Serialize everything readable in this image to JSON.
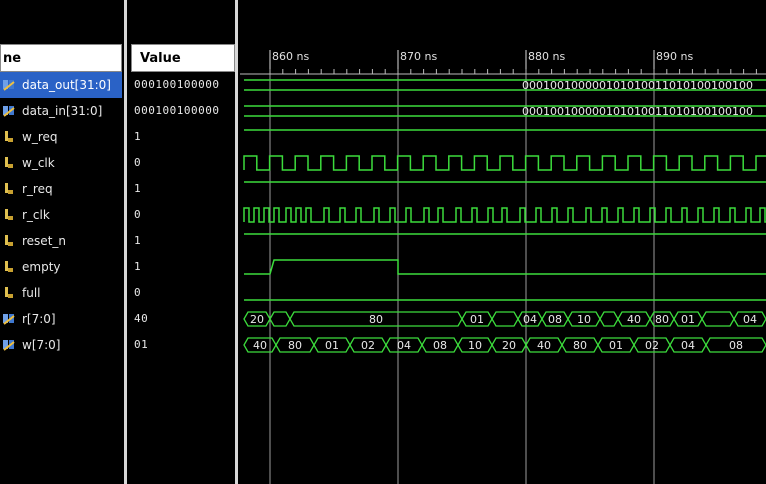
{
  "header": {
    "name_label": "ne",
    "value_label": "Value"
  },
  "time_ticks": [
    "860 ns",
    "870 ns",
    "880 ns",
    "890 ns"
  ],
  "signals": [
    {
      "name": "data_out[31:0]",
      "value": "000100100000",
      "icon": "bus-icon",
      "selected": true
    },
    {
      "name": "data_in[31:0]",
      "value": "000100100000",
      "icon": "bus-icon",
      "selected": false
    },
    {
      "name": "w_req",
      "value": "1",
      "icon": "wire-icon",
      "selected": false
    },
    {
      "name": "w_clk",
      "value": "0",
      "icon": "wire-icon",
      "selected": false
    },
    {
      "name": "r_req",
      "value": "1",
      "icon": "wire-icon",
      "selected": false
    },
    {
      "name": "r_clk",
      "value": "0",
      "icon": "wire-icon",
      "selected": false
    },
    {
      "name": "reset_n",
      "value": "1",
      "icon": "wire-icon",
      "selected": false
    },
    {
      "name": "empty",
      "value": "1",
      "icon": "wire-icon",
      "selected": false
    },
    {
      "name": "full",
      "value": "0",
      "icon": "wire-icon",
      "selected": false
    },
    {
      "name": "r[7:0]",
      "value": "40",
      "icon": "bus-icon",
      "selected": false
    },
    {
      "name": "w[7:0]",
      "value": "01",
      "icon": "bus-icon",
      "selected": false
    }
  ],
  "data_bus_text": "000100100000101010011010100100100",
  "r_bus_values": [
    "20",
    "",
    "80",
    "01",
    "",
    "04",
    "08",
    "10",
    "",
    "40",
    "80",
    "01",
    "",
    "04"
  ],
  "w_bus_values": [
    "40",
    "80",
    "01",
    "02",
    "04",
    "08",
    "10",
    "20",
    "40",
    "80",
    "01",
    "02",
    "04",
    "08"
  ],
  "colors": {
    "wave": "#3cdc3c",
    "selection": "#2a62c6",
    "cursor": "#cfcfcf"
  }
}
